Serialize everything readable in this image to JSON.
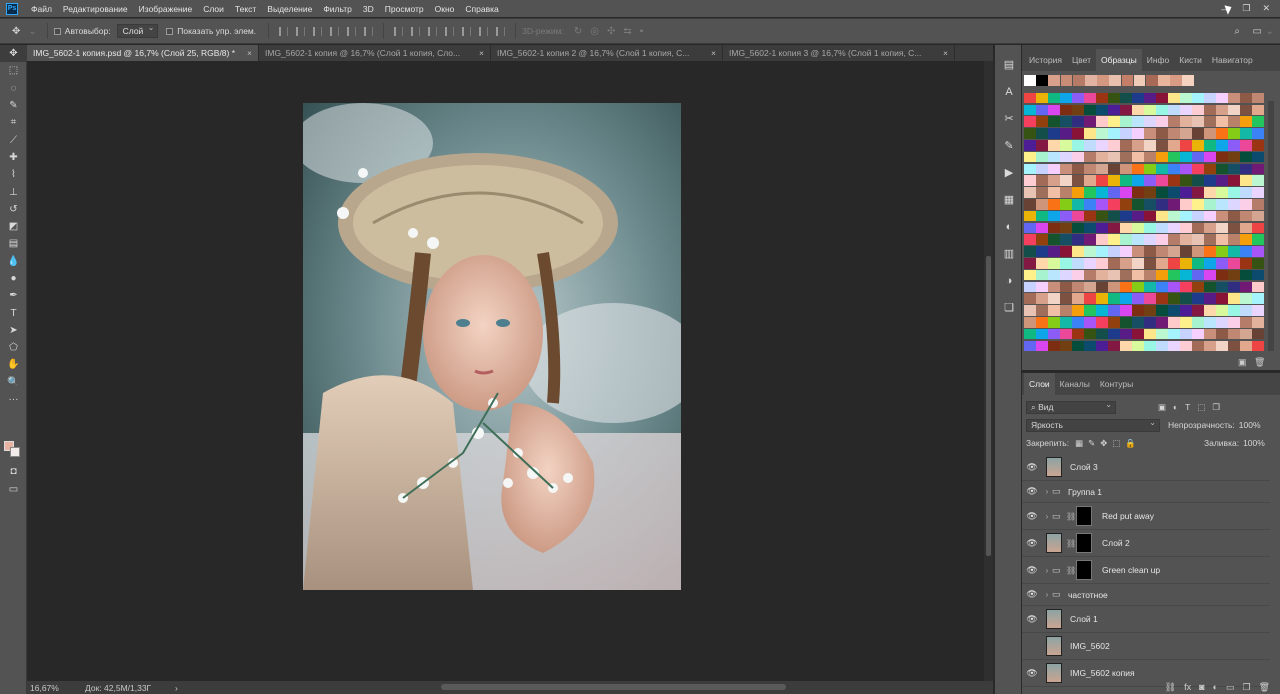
{
  "menubar": {
    "logo": "Ps",
    "items": [
      "Файл",
      "Редактирование",
      "Изображение",
      "Слои",
      "Текст",
      "Выделение",
      "Фильтр",
      "3D",
      "Просмотр",
      "Окно",
      "Справка"
    ]
  },
  "optionsbar": {
    "autoselect_label": "Автовыбор:",
    "autoselect_value": "Слой",
    "show_transform_label": "Показать упр. элем.",
    "mode_3d_label": "3D-режим:"
  },
  "tabs": [
    {
      "label": "IMG_5602-1 копия.psd @ 16,7% (Слой 25, RGB/8) *",
      "active": true
    },
    {
      "label": "IMG_5602-1 копия @ 16,7% (Слой 1 копия, Сло...",
      "active": false
    },
    {
      "label": "IMG_5602-1 копия 2 @ 16,7% (Слой 1 копия, С...",
      "active": false
    },
    {
      "label": "IMG_5602-1 копия 3 @ 16,7% (Слой 1 копия, С...",
      "active": false
    }
  ],
  "status": {
    "zoom": "16,67%",
    "doc": "Док: 42,5M/1,33Г",
    "arrow": "›"
  },
  "top_panel": {
    "tabs": [
      "История",
      "Цвет",
      "Образцы",
      "Инфо",
      "Кисти",
      "Навигатор"
    ],
    "active_tab": "Образцы"
  },
  "layers_panel": {
    "tabs": [
      "Слои",
      "Каналы",
      "Контуры"
    ],
    "active_tab": "Слои",
    "filter_label": "Вид",
    "blend_mode": "Яркость",
    "opacity_label": "Непрозрачность:",
    "opacity_value": "100%",
    "lock_label": "Закрепить:",
    "fill_label": "Заливка:",
    "fill_value": "100%",
    "layers": [
      {
        "name": "Слой 3",
        "type": "image",
        "visible": true
      },
      {
        "name": "Группа 1",
        "type": "group",
        "visible": true
      },
      {
        "name": "Red put away",
        "type": "group-mask",
        "visible": true
      },
      {
        "name": "Слой 2",
        "type": "image-mask",
        "visible": true
      },
      {
        "name": "Green clean up",
        "type": "group-mask",
        "visible": true
      },
      {
        "name": "частотное",
        "type": "group",
        "visible": true
      },
      {
        "name": "Слой 1",
        "type": "image",
        "visible": true
      },
      {
        "name": "IMG_5602",
        "type": "image",
        "visible": false
      },
      {
        "name": "IMG_5602 копия",
        "type": "image",
        "visible": true
      }
    ]
  },
  "colors": {
    "foreground": "#e7b29f",
    "background": "#f1ece9",
    "ui_panel": "#535353",
    "ui_dark": "#282828",
    "accent": "#31a8ff"
  },
  "icons": {
    "toolbar": [
      "move-icon",
      "marquee-icon",
      "lasso-icon",
      "quick-select-icon",
      "crop-icon",
      "eyedropper-icon",
      "healing-icon",
      "brush-icon",
      "stamp-icon",
      "history-brush-icon",
      "eraser-icon",
      "gradient-icon",
      "blur-icon",
      "dodge-icon",
      "pen-icon",
      "type-icon",
      "path-select-icon",
      "shape-icon",
      "hand-icon",
      "zoom-icon",
      "more-tools-icon"
    ],
    "dock": [
      "history-icon",
      "character-icon",
      "tools-preset-icon",
      "brush-settings-icon",
      "actions-icon",
      "histogram-icon",
      "adjustments-icon",
      "properties-icon",
      "styles-icon",
      "libraries-icon"
    ]
  }
}
